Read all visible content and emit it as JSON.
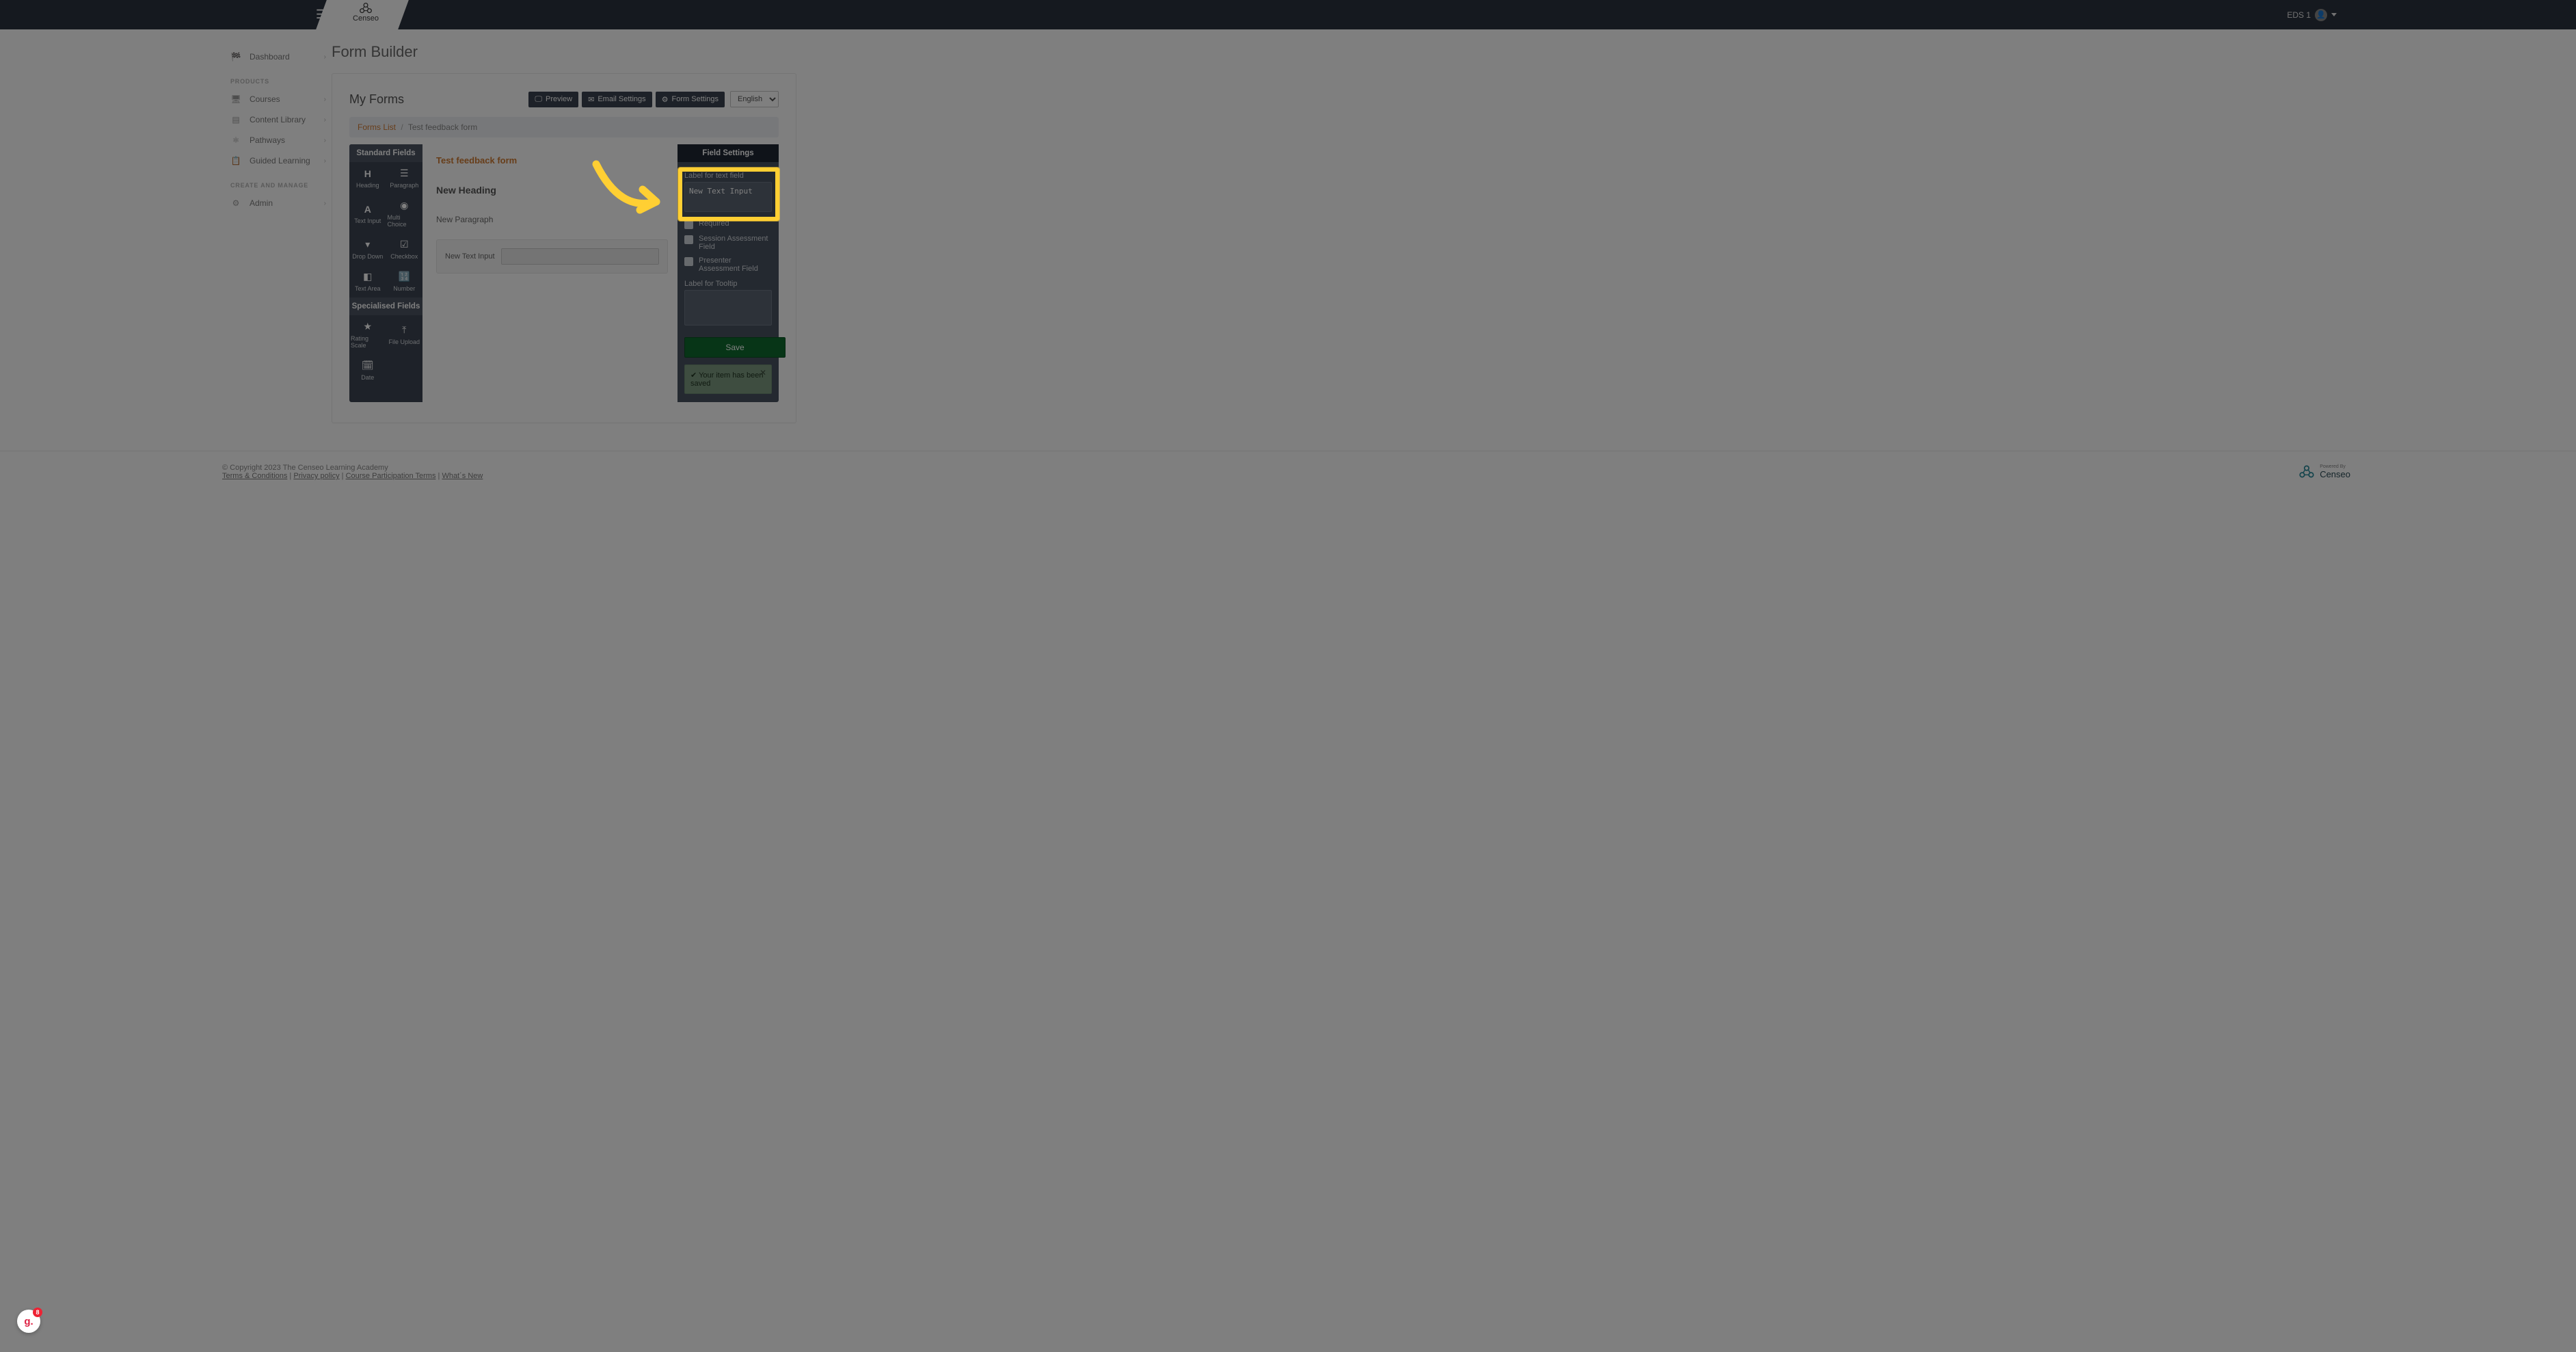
{
  "topnav": {
    "brand_name": "Censeo",
    "user_label": "EDS 1"
  },
  "sidebar": {
    "items": [
      {
        "icon": "📊",
        "label": "Dashboard"
      }
    ],
    "group_products": "PRODUCTS",
    "products": [
      {
        "icon": "🖥",
        "label": "Courses"
      },
      {
        "icon": "📚",
        "label": "Content Library"
      },
      {
        "icon": "🔀",
        "label": "Pathways"
      },
      {
        "icon": "📋",
        "label": "Guided Learning"
      }
    ],
    "group_manage": "CREATE AND MANAGE",
    "manage": [
      {
        "icon": "⚙",
        "label": "Admin"
      }
    ]
  },
  "page": {
    "title": "Form Builder"
  },
  "card": {
    "heading": "My Forms",
    "btn_preview": "Preview",
    "btn_email": "Email Settings",
    "btn_form": "Form Settings",
    "lang": "English"
  },
  "breadcrumb": {
    "root": "Forms List",
    "sep": "/",
    "leaf": "Test feedback form"
  },
  "palette": {
    "head_std": "Standard Fields",
    "std": [
      {
        "icon": "H",
        "label": "Heading"
      },
      {
        "icon": "☰",
        "label": "Paragraph"
      },
      {
        "icon": "A",
        "label": "Text Input"
      },
      {
        "icon": "✔",
        "label": "Multi Choice"
      },
      {
        "icon": "▾",
        "label": "Drop Down"
      },
      {
        "icon": "☑",
        "label": "Checkbox"
      },
      {
        "icon": "¶",
        "label": "Text Area"
      },
      {
        "icon": "🔢",
        "label": "Number"
      }
    ],
    "head_spec": "Specialised Fields",
    "spec": [
      {
        "icon": "★",
        "label": "Rating Scale"
      },
      {
        "icon": "⤒",
        "label": "File Upload"
      },
      {
        "icon": "🗓",
        "label": "Date"
      }
    ]
  },
  "canvas": {
    "form_name": "Test feedback form",
    "heading": "New Heading",
    "paragraph": "New Paragraph",
    "text_label": "New Text Input"
  },
  "props": {
    "title": "Field Settings",
    "label_for_text": "Label for text field",
    "label_value": "New Text Input",
    "chk_required": "Required",
    "chk_session": "Session Assessment Field",
    "chk_presenter": "Presenter Assessment Field",
    "label_tooltip": "Label for Tooltip",
    "tooltip_value": "",
    "save": "Save",
    "alert": "Your item has been saved"
  },
  "footer": {
    "copyright": "© Copyright 2023 The Censeo Learning Academy",
    "links": {
      "terms": "Terms & Conditions",
      "privacy": "Privacy policy",
      "course_terms": "Course Participation Terms",
      "whats_new": "What´s New"
    },
    "sep": " | ",
    "powered": "Powered By",
    "powered_brand": "Censeo"
  },
  "badge": {
    "glyph": "g.",
    "count": "8"
  }
}
